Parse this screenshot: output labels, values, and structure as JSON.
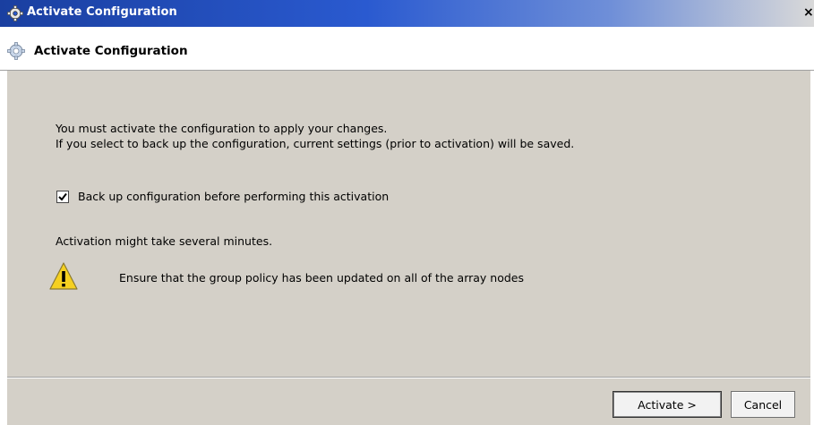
{
  "window": {
    "title": "Activate Configuration",
    "close_glyph": "×"
  },
  "header": {
    "title": "Activate Configuration",
    "icon": "gear-icon"
  },
  "body": {
    "message_line1": "You must activate the configuration to apply your changes.",
    "message_line2": "If you select to back up the configuration, current settings (prior to activation) will be saved.",
    "backup_checkbox": {
      "label": "Back up configuration before performing this activation",
      "checked": true
    },
    "activation_note": "Activation might take several minutes.",
    "warning": {
      "icon": "warning-icon",
      "text": "Ensure that the group policy has been updated on all of the array nodes"
    }
  },
  "footer": {
    "activate_label": "Activate >",
    "cancel_label": "Cancel"
  }
}
